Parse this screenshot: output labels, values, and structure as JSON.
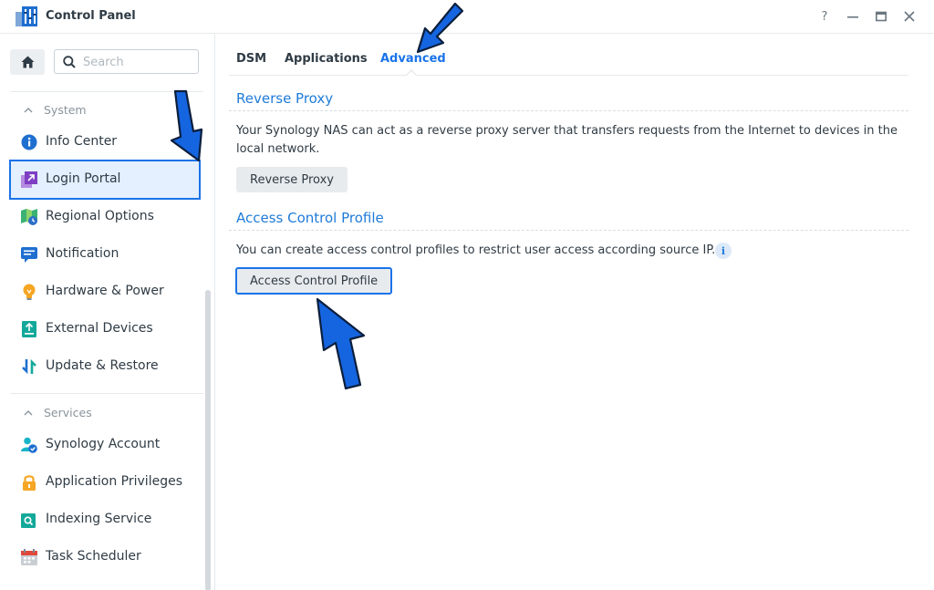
{
  "window": {
    "title": "Control Panel",
    "controls": {
      "help": "?",
      "minimize": "—",
      "maximize": "▭",
      "close": "✕"
    }
  },
  "sidebar": {
    "search": {
      "placeholder": "Search",
      "value": ""
    },
    "groups": [
      {
        "label": "System",
        "items": [
          {
            "label": "Info Center",
            "icon": "info-circle-icon"
          },
          {
            "label": "Login Portal",
            "icon": "login-portal-icon",
            "selected": true
          },
          {
            "label": "Regional Options",
            "icon": "regional-options-icon"
          },
          {
            "label": "Notification",
            "icon": "notification-icon"
          },
          {
            "label": "Hardware & Power",
            "icon": "lightbulb-icon"
          },
          {
            "label": "External Devices",
            "icon": "external-device-icon"
          },
          {
            "label": "Update & Restore",
            "icon": "update-restore-icon"
          }
        ]
      },
      {
        "label": "Services",
        "items": [
          {
            "label": "Synology Account",
            "icon": "synology-account-icon"
          },
          {
            "label": "Application Privileges",
            "icon": "lock-icon"
          },
          {
            "label": "Indexing Service",
            "icon": "indexing-service-icon"
          },
          {
            "label": "Task Scheduler",
            "icon": "calendar-icon"
          }
        ]
      }
    ]
  },
  "tabs": [
    {
      "label": "DSM"
    },
    {
      "label": "Applications"
    },
    {
      "label": "Advanced",
      "active": true
    }
  ],
  "reverse_proxy": {
    "title": "Reverse Proxy",
    "description_line1": "Your Synology NAS can act as a reverse proxy server that transfers requests from the Internet to devices in the",
    "description_line2": "local network.",
    "button": "Reverse Proxy"
  },
  "access_control": {
    "title": "Access Control Profile",
    "description": "You can create access control profiles to restrict user access according source IP.",
    "info": "i",
    "button": "Access Control Profile"
  },
  "colors": {
    "accent": "#1a73e8",
    "section_title": "#1f7bd8",
    "selected_bg": "#e4efff",
    "annotation_arrow": "#1565e0"
  }
}
